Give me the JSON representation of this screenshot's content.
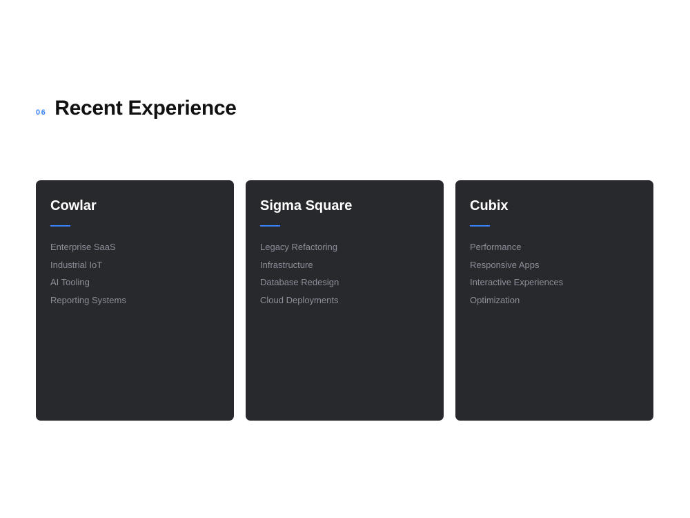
{
  "section": {
    "number": "06",
    "title": "Recent Experience"
  },
  "cards": [
    {
      "title": "Cowlar",
      "items": [
        "Enterprise SaaS",
        "Industrial IoT",
        "AI Tooling",
        "Reporting Systems"
      ]
    },
    {
      "title": "Sigma Square",
      "items": [
        "Legacy Refactoring",
        "Infrastructure",
        "Database Redesign",
        "Cloud Deployments"
      ]
    },
    {
      "title": "Cubix",
      "items": [
        "Performance",
        "Responsive Apps",
        "Interactive Experiences",
        "Optimization"
      ]
    }
  ],
  "colors": {
    "accent": "#3b82f6",
    "card_background": "#28292d",
    "card_text_muted": "#8c8f99",
    "heading": "#111111"
  }
}
